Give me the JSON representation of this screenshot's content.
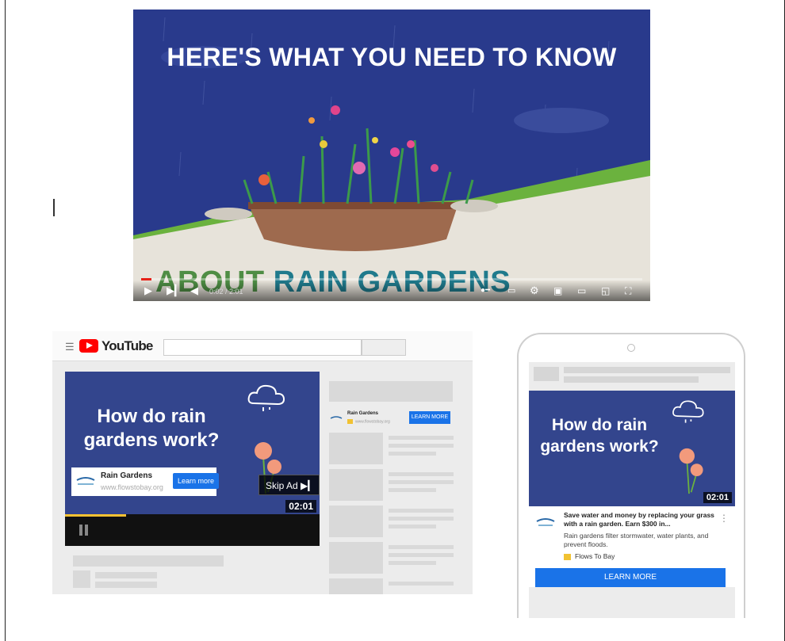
{
  "main_video": {
    "headline": "HERE'S WHAT YOU NEED TO KNOW",
    "subheadline_part1": "ABOUT",
    "subheadline_part2": "RAIN GARDENS",
    "time": "0:02 / 2:01",
    "progress": 0.02
  },
  "desktop": {
    "site_name": "YouTube",
    "video_title": "How do rain gardens work?",
    "ad_card": {
      "name": "Rain Gardens",
      "url": "www.flowstobay.org",
      "button": "Learn more"
    },
    "skip_ad": "Skip Ad ▶▎",
    "duration": "02:01",
    "progress": 0.24,
    "side_ad": {
      "name": "Rain Gardens",
      "sub": "www.flowstobay.org",
      "button": "LEARN MORE"
    }
  },
  "phone": {
    "video_title": "How do rain gardens work?",
    "duration": "02:01",
    "ad": {
      "headline": "Save water and money by replacing your grass with a rain garden. Earn $300 in...",
      "description": "Rain gardens filter stormwater, water plants, and prevent floods.",
      "advertiser": "Flows To Bay",
      "button": "LEARN MORE"
    }
  },
  "colors": {
    "video_bg": "#293a8c",
    "cta_blue": "#1a73e8",
    "youtube_red": "#ff0000"
  }
}
